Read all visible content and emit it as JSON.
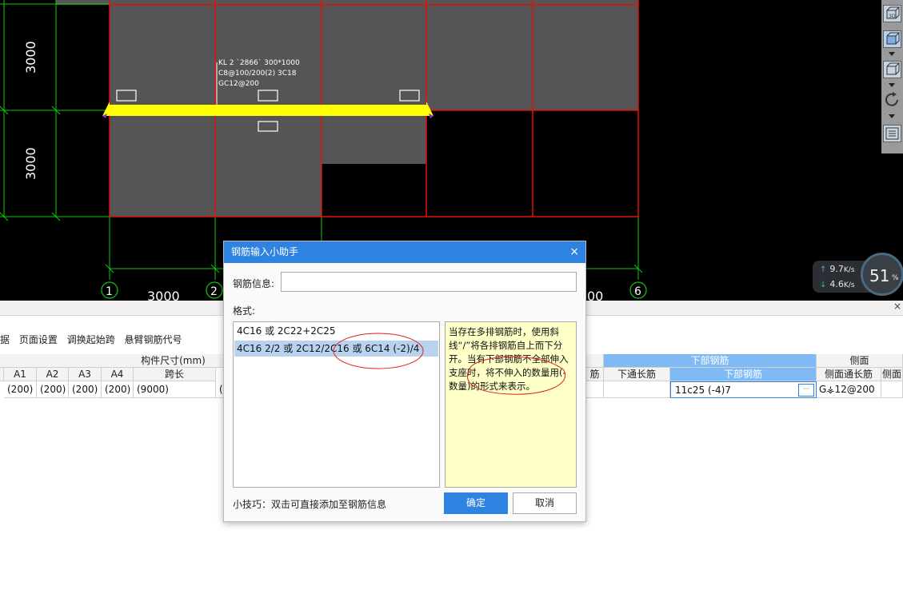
{
  "cad": {
    "dim_left_upper": "3000",
    "dim_left_lower": "3000",
    "dim_bottom": "3000",
    "dim_bottom_right": "00",
    "axis_labels": [
      "1",
      "2",
      "6"
    ],
    "beam_annotation": [
      "KL 2 `2866` 300*1000",
      "C8@100/200(2) 3C18",
      "GC12@200"
    ]
  },
  "speed": {
    "up": "9.7",
    "up_unit": "K/s",
    "down": "4.6",
    "down_unit": "K/s",
    "cpu": "51",
    "cpu_unit": "%"
  },
  "panel": {
    "close": "×",
    "toolbar": [
      "据",
      "页面设置",
      "调换起始跨",
      "悬臂钢筋代号"
    ],
    "header_group": "构件尺寸(mm)",
    "header_bottom_group": "下部钢筋",
    "header_side_group": "侧面",
    "cols": [
      "A1",
      "A2",
      "A3",
      "A4",
      "跨长"
    ],
    "col_right": [
      "筋",
      "下通长筋",
      "下部钢筋",
      "侧面通长筋",
      "侧面"
    ],
    "row": [
      "(200)",
      "(200)",
      "(200)",
      "(200)",
      "(9000)",
      "(3"
    ],
    "edit_value": "11c25 (-4)7",
    "edit_btn": "···",
    "side_value": "G⚶12@200"
  },
  "dialog": {
    "title": "钢筋输入小助手",
    "close": "×",
    "info_label": "钢筋信息:",
    "info_value": "",
    "format_label": "格式:",
    "formats": [
      "4C16 或 2C22+2C25",
      "4C16 2/2 或 2C12/2C16 或 6C14 (-2)/4"
    ],
    "tip": "当存在多排钢筋时，使用斜线“/”将各排钢筋自上而下分开。当有下部钢筋不全部伸入支座时，将不伸入的数量用(-数量)的形式来表示。",
    "hint": "小技巧：双击可直接添加至钢筋信息",
    "ok": "确定",
    "cancel": "取消"
  }
}
